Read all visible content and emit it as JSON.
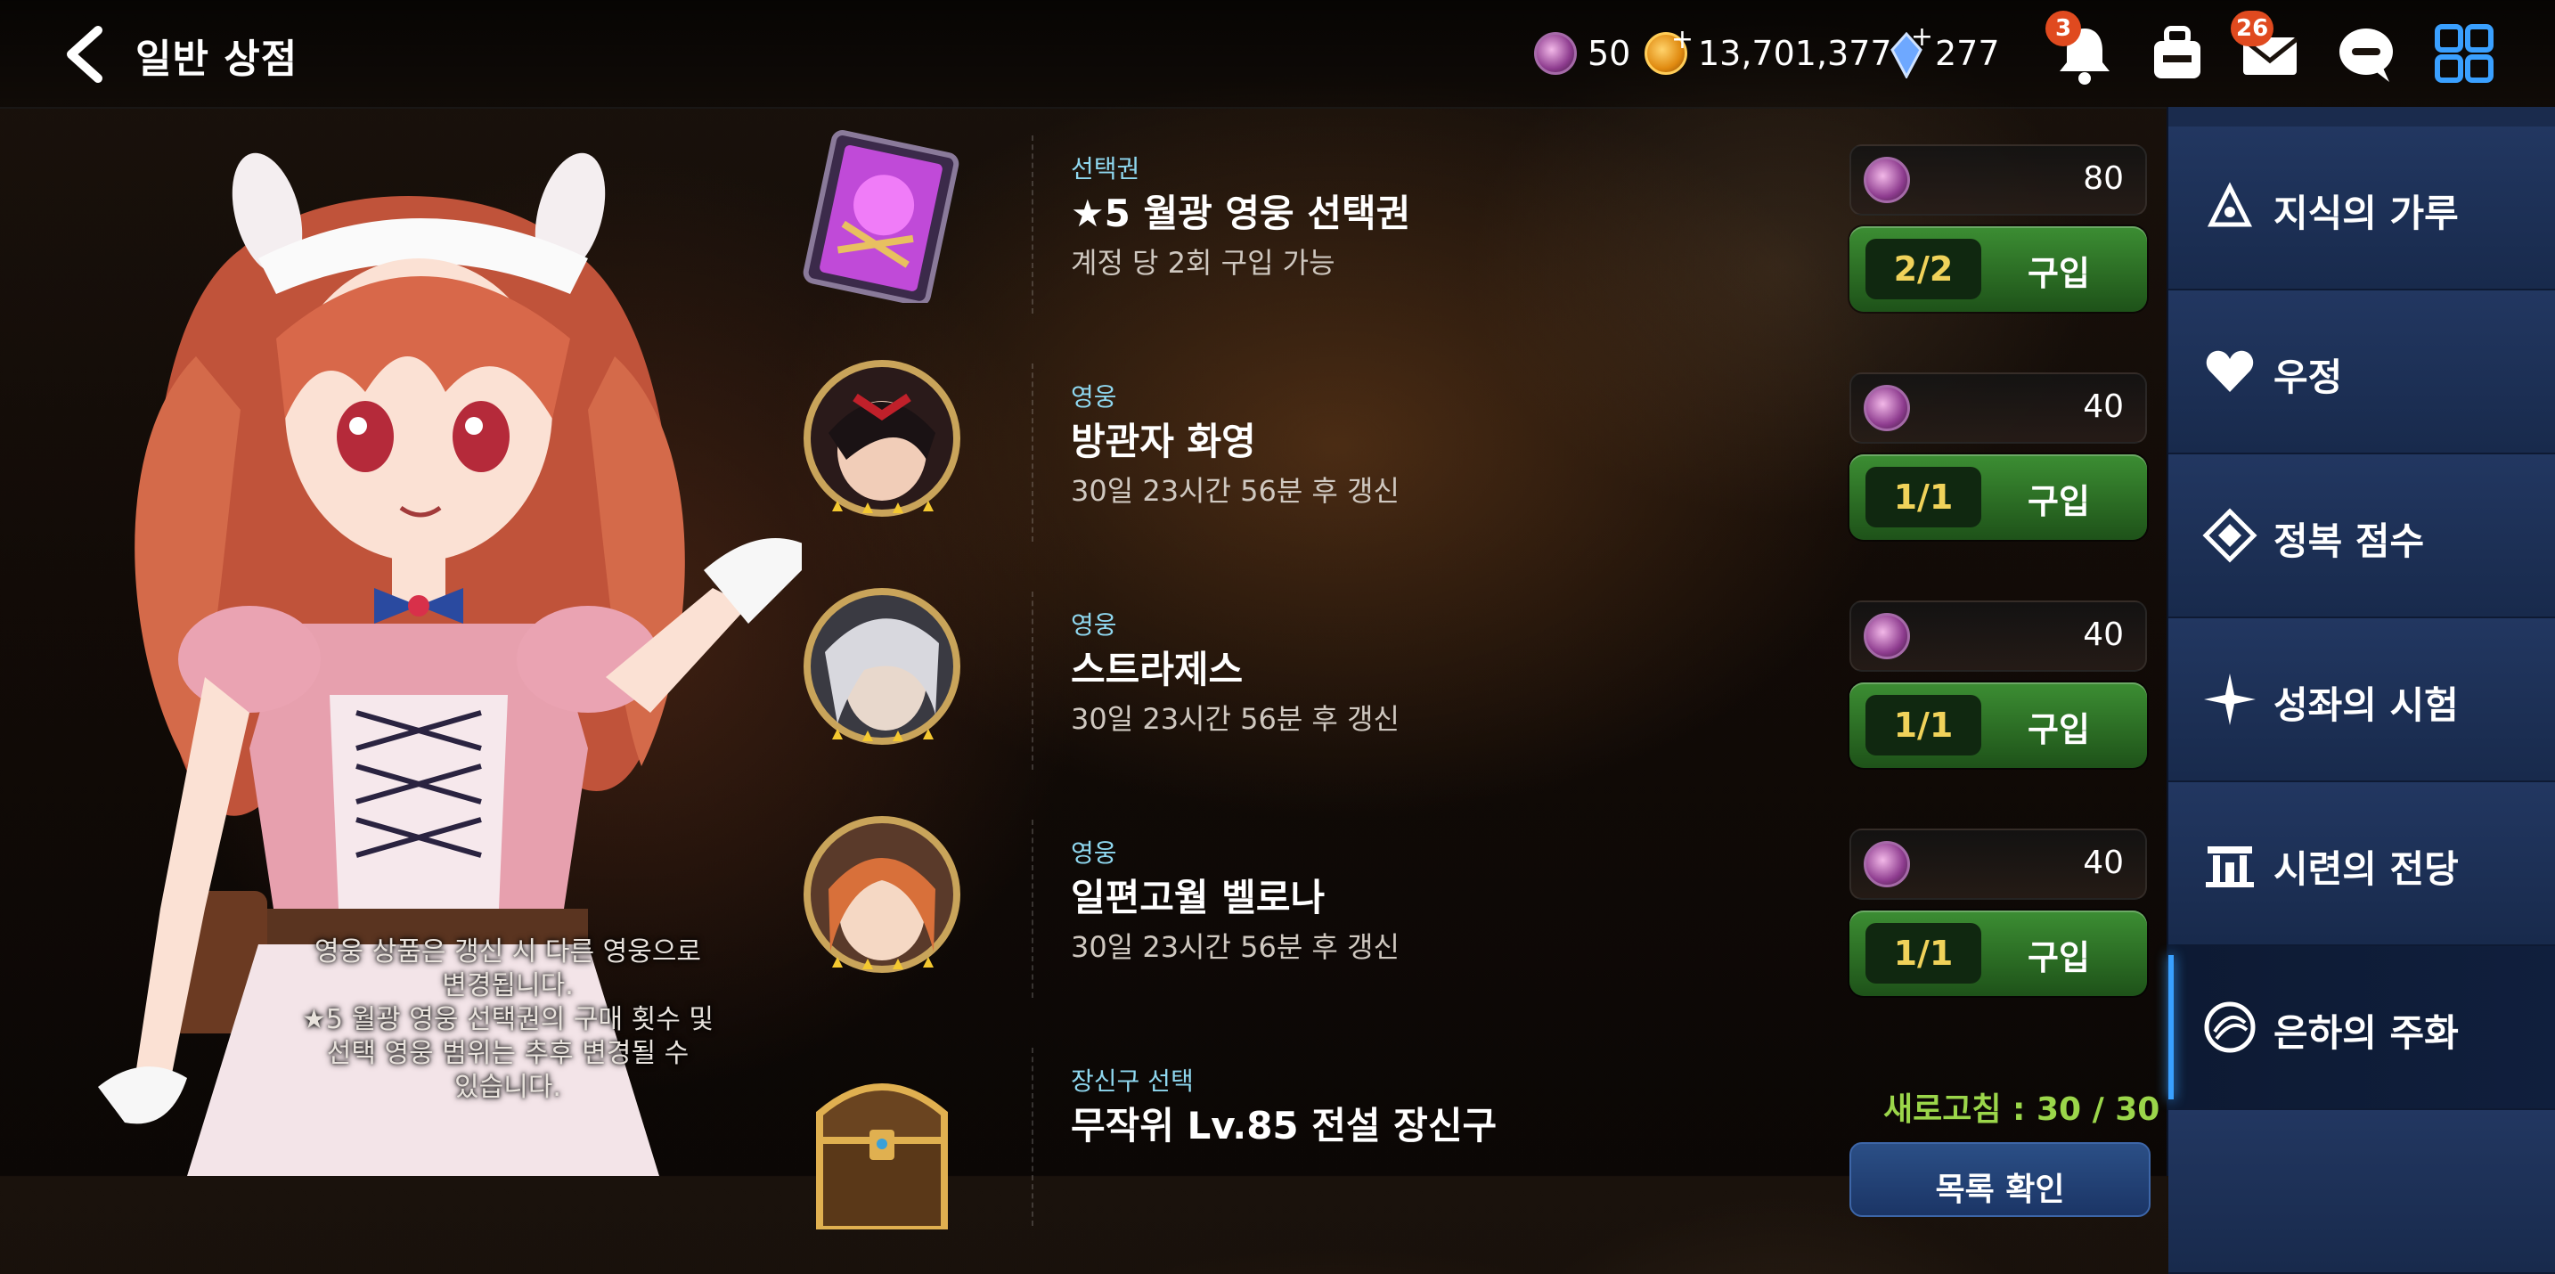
{
  "header": {
    "title": "일반 상점",
    "currencies": {
      "moon": "50",
      "gold": "13,701,377",
      "crystal": "277"
    },
    "badges": {
      "notifications": "3",
      "mail": "26"
    }
  },
  "notice": {
    "line1": "영웅 상품은 갱신 시 다른 영웅으로",
    "line2": "변경됩니다.",
    "line3": "★5 월광 영웅 선택권의 구매 횟수 및",
    "line4": "선택 영웅 범위는 추후 변경될 수",
    "line5": "있습니다."
  },
  "shop": {
    "items": [
      {
        "category": "선택권",
        "name": "★5 월광 영웅 선택권",
        "sub": "계정 당 2회 구입 가능",
        "price": "80",
        "count": "2/2",
        "buy": "구입"
      },
      {
        "category": "영웅",
        "name": "방관자 화영",
        "sub": "30일 23시간 56분 후 갱신",
        "price": "40",
        "count": "1/1",
        "buy": "구입"
      },
      {
        "category": "영웅",
        "name": "스트라제스",
        "sub": "30일 23시간 56분 후 갱신",
        "price": "40",
        "count": "1/1",
        "buy": "구입"
      },
      {
        "category": "영웅",
        "name": "일편고월 벨로나",
        "sub": "30일 23시간 56분 후 갱신",
        "price": "40",
        "count": "1/1",
        "buy": "구입"
      },
      {
        "category": "장신구 선택",
        "name": "무작위 Lv.85 전설 장신구"
      }
    ],
    "refresh": "새로고침 : 30 / 30",
    "bottom_button": "목록 확인"
  },
  "sidebar": {
    "items": [
      {
        "label": "지식의 가루",
        "icon": "knowledge-icon"
      },
      {
        "label": "우정",
        "icon": "heart-icon"
      },
      {
        "label": "정복 점수",
        "icon": "conquest-icon"
      },
      {
        "label": "성좌의 시험",
        "icon": "star-icon"
      },
      {
        "label": "시련의 전당",
        "icon": "hall-icon"
      },
      {
        "label": "은하의 주화",
        "icon": "galaxy-coin-icon"
      }
    ]
  },
  "colors": {
    "accent_blue": "#39a0ff",
    "buy_green": "#2f7a28",
    "count_yellow": "#f0d25a",
    "refresh_green": "#9bd64a",
    "category_cyan": "#8fd8f0"
  }
}
